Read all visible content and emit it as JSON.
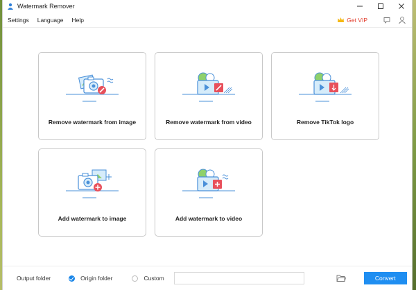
{
  "app": {
    "title": "Watermark Remover"
  },
  "window_controls": {
    "minimize": "—",
    "maximize": "☐",
    "close": "✕"
  },
  "menu": {
    "items": [
      "Settings",
      "Language",
      "Help"
    ],
    "vip_label": "Get VIP"
  },
  "cards": [
    {
      "label": "Remove watermark from image",
      "icon": "image-remove-icon"
    },
    {
      "label": "Remove watermark from video",
      "icon": "video-remove-icon"
    },
    {
      "label": "Remove TikTok logo",
      "icon": "tiktok-remove-icon"
    },
    {
      "label": "Add watermark to image",
      "icon": "image-add-icon"
    },
    {
      "label": "Add watermark to video",
      "icon": "video-add-icon"
    }
  ],
  "footer": {
    "output_folder_label": "Output folder",
    "origin_folder_label": "Origin folder",
    "custom_label": "Custom",
    "path_value": "",
    "convert_label": "Convert",
    "selected": "Origin folder"
  },
  "colors": {
    "accent": "#1f8ef1",
    "vip": "#e23b2a",
    "icon_blue": "#4a90d9",
    "icon_red": "#e8505b"
  }
}
